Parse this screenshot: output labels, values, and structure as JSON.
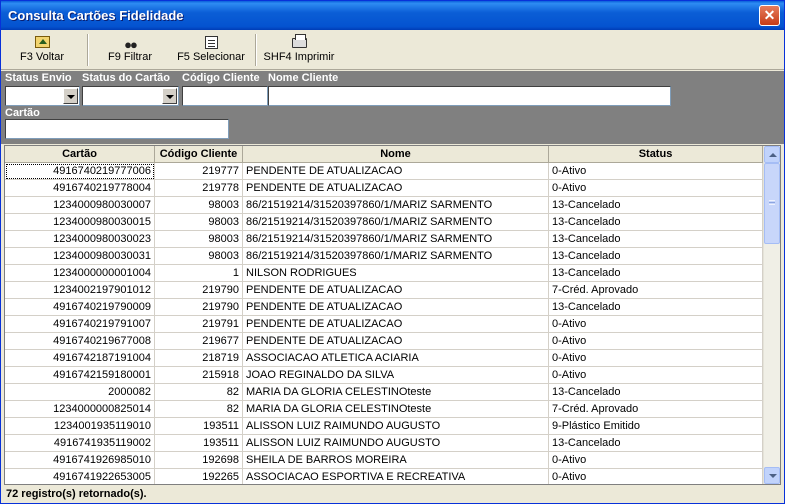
{
  "window": {
    "title": "Consulta Cartões Fidelidade",
    "close_glyph": "✕"
  },
  "toolbar": {
    "buttons": [
      {
        "label": "F3 Voltar",
        "icon": "back-folder-icon"
      },
      {
        "label": "F9 Filtrar",
        "icon": "binoculars-icon"
      },
      {
        "label": "F5 Selecionar",
        "icon": "select-list-icon"
      },
      {
        "label": "SHF4 Imprimir",
        "icon": "printer-icon"
      }
    ]
  },
  "filters": {
    "status_envio": {
      "label": "Status Envio",
      "value": ""
    },
    "status_cartao": {
      "label": "Status do Cartão",
      "value": ""
    },
    "codigo_cliente": {
      "label": "Código Cliente",
      "value": ""
    },
    "nome_cliente": {
      "label": "Nome Cliente",
      "value": ""
    },
    "cartao": {
      "label": "Cartão",
      "value": ""
    }
  },
  "grid": {
    "columns": [
      "Cartão",
      "Código Cliente",
      "Nome",
      "Status"
    ],
    "rows": [
      [
        "4916740219777006",
        "219777",
        "PENDENTE DE ATUALIZACAO",
        "0-Ativo"
      ],
      [
        "4916740219778004",
        "219778",
        "PENDENTE DE ATUALIZACAO",
        "0-Ativo"
      ],
      [
        "1234000980030007",
        "98003",
        "86/21519214/31520397860/1/MARIZ SARMENTO",
        "13-Cancelado"
      ],
      [
        "1234000980030015",
        "98003",
        "86/21519214/31520397860/1/MARIZ SARMENTO",
        "13-Cancelado"
      ],
      [
        "1234000980030023",
        "98003",
        "86/21519214/31520397860/1/MARIZ SARMENTO",
        "13-Cancelado"
      ],
      [
        "1234000980030031",
        "98003",
        "86/21519214/31520397860/1/MARIZ SARMENTO",
        "13-Cancelado"
      ],
      [
        "1234000000001004",
        "1",
        "NILSON RODRIGUES",
        "13-Cancelado"
      ],
      [
        "1234002197901012",
        "219790",
        "PENDENTE DE ATUALIZACAO",
        "7-Créd. Aprovado"
      ],
      [
        "4916740219790009",
        "219790",
        "PENDENTE DE ATUALIZACAO",
        "13-Cancelado"
      ],
      [
        "4916740219791007",
        "219791",
        "PENDENTE DE ATUALIZACAO",
        "0-Ativo"
      ],
      [
        "4916740219677008",
        "219677",
        "PENDENTE DE ATUALIZACAO",
        "0-Ativo"
      ],
      [
        "4916742187191004",
        "218719",
        "ASSOCIACAO ATLETICA ACIARIA",
        "0-Ativo"
      ],
      [
        "4916742159180001",
        "215918",
        "JOAO REGINALDO DA SILVA",
        "0-Ativo"
      ],
      [
        "2000082",
        "82",
        "MARIA DA GLORIA CELESTINOteste",
        "13-Cancelado"
      ],
      [
        "1234000000825014",
        "82",
        "MARIA DA GLORIA CELESTINOteste",
        "7-Créd. Aprovado"
      ],
      [
        "1234001935119010",
        "193511",
        "ALISSON LUIZ RAIMUNDO AUGUSTO",
        "9-Plástico Emitido"
      ],
      [
        "4916741935119002",
        "193511",
        "ALISSON LUIZ RAIMUNDO AUGUSTO",
        "13-Cancelado"
      ],
      [
        "4916741926985010",
        "192698",
        "SHEILA DE BARROS MOREIRA",
        "0-Ativo"
      ],
      [
        "4916741922653005",
        "192265",
        "ASSOCIACAO ESPORTIVA E RECREATIVA",
        "0-Ativo"
      ]
    ]
  },
  "status": {
    "text": "72 registro(s) retornado(s)."
  }
}
